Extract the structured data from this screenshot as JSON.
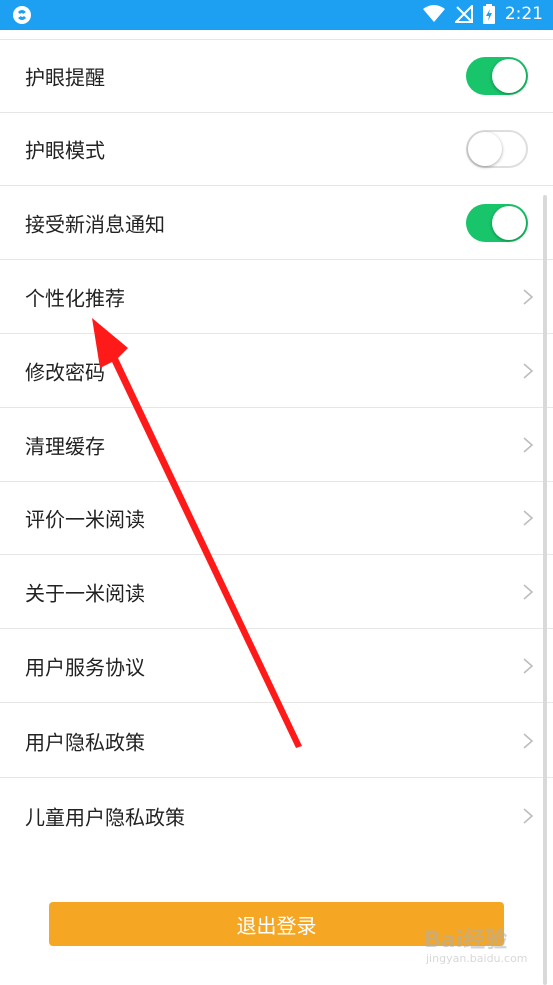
{
  "status_bar": {
    "time": "2:21",
    "icons": [
      "app-logo-icon",
      "wifi-icon",
      "no-signal-icon",
      "battery-charging-icon"
    ]
  },
  "settings": {
    "items": [
      {
        "label": "护眼提醒",
        "control": "toggle",
        "state": "on"
      },
      {
        "label": "护眼模式",
        "control": "toggle",
        "state": "off"
      },
      {
        "label": "接受新消息通知",
        "control": "toggle",
        "state": "on"
      },
      {
        "label": "个性化推荐",
        "control": "chevron"
      },
      {
        "label": "修改密码",
        "control": "chevron"
      },
      {
        "label": "清理缓存",
        "control": "chevron"
      },
      {
        "label": "评价一米阅读",
        "control": "chevron"
      },
      {
        "label": "关于一米阅读",
        "control": "chevron"
      },
      {
        "label": "用户服务协议",
        "control": "chevron"
      },
      {
        "label": "用户隐私政策",
        "control": "chevron"
      },
      {
        "label": "儿童用户隐私政策",
        "control": "chevron"
      }
    ]
  },
  "logout_button": {
    "label": "退出登录"
  },
  "watermark": {
    "text": "Bai经验",
    "sub": "jingyan.baidu.com"
  },
  "colors": {
    "status_bar": "#1da0f2",
    "toggle_on": "#18c56a",
    "logout": "#f5a623",
    "annotation_arrow": "#ff1a1a"
  }
}
